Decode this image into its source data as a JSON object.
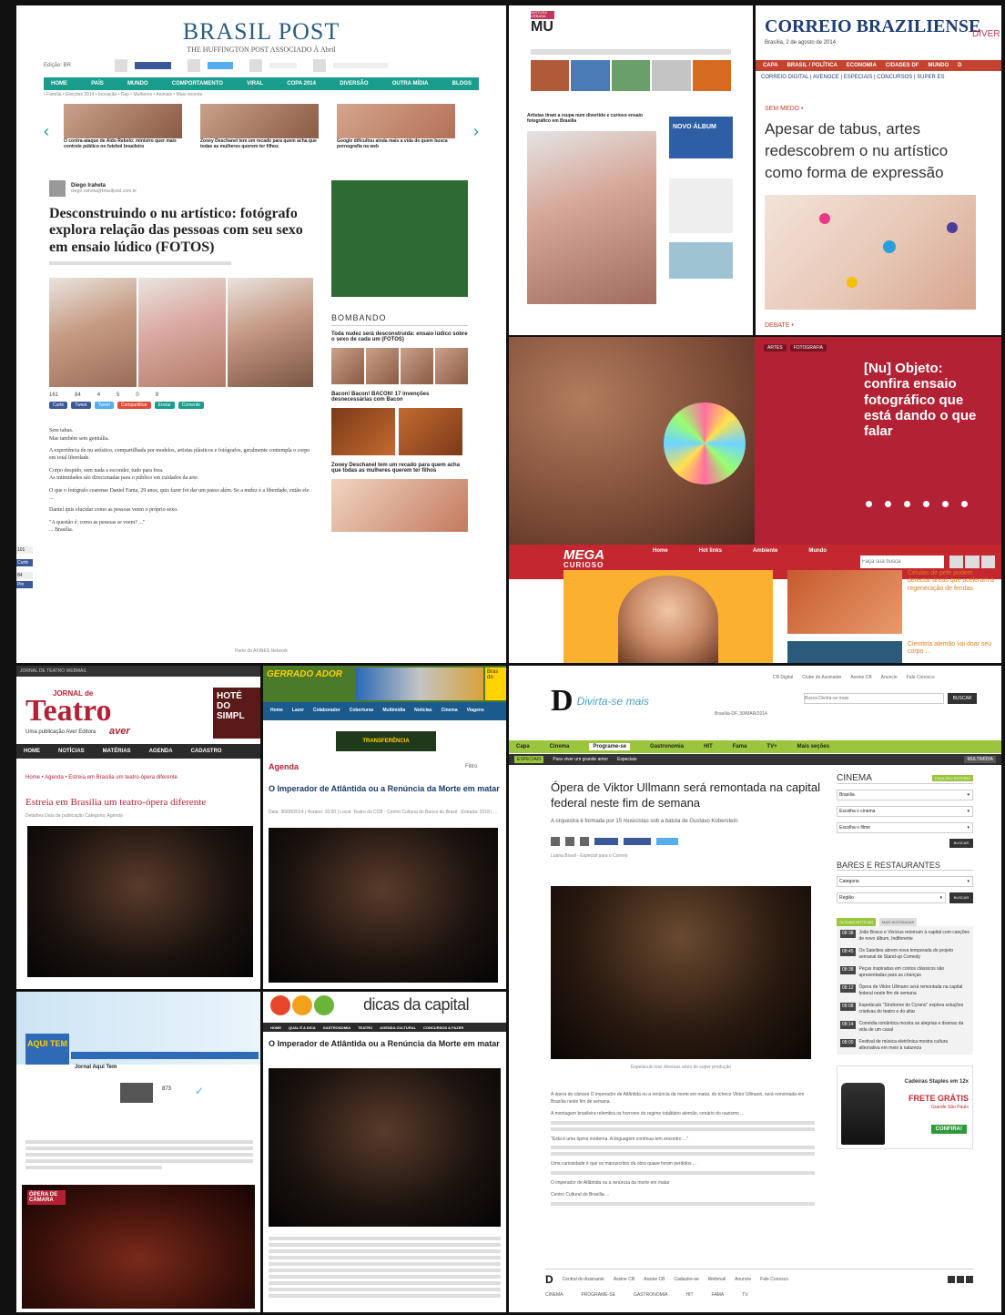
{
  "brasil_post": {
    "logo": "BRASIL POST",
    "subtitle": "THE HUFFINGTON POST ASSOCIADO À Abril",
    "edition": "Edição: BR",
    "nav": [
      "HOME",
      "PAÍS",
      "MUNDO",
      "COMPORTAMENTO",
      "VIRAL",
      "COPA 2014",
      "DIVERSÃO",
      "OUTRA MÍDIA",
      "BLOGS"
    ],
    "breadcrumb": "• Família • Eleições 2014 • Inovação • Gay • Mulheres • Animais • Mais recente",
    "carousel": [
      "O contra-ataque de Aldo Rebelo: ministro quer mais controle público no futebol brasileiro",
      "Zooey Deschanel tem um recado para quem acha que todas as mulheres querem ter filhos",
      "Google dificultou ainda mais a vida de quem busca pornografia na web"
    ],
    "author": "Diego Iraheta",
    "author_email": "diego.iraheta@brasilpost.com.br",
    "headline": "Desconstruindo o nu artístico: fotógrafo explora relação das pessoas com seu sexo em ensaio lúdico (FOTOS)",
    "counts": [
      "161",
      "84",
      "4",
      "5",
      "0",
      "9"
    ],
    "share_buttons": [
      "Curtir",
      "Tweet",
      "Tweet",
      "Compartilhar",
      "Enviar",
      "Comente"
    ],
    "body": [
      "Sem tabus.",
      "Mas também sem genitália.",
      "A experiência do nu artístico, compartilhada por modelos, artistas plásticos e fotógrafos, geralmente contempla o corpo em total liberdade.",
      "Corpo despido, sem nada a esconder, tudo para fora.",
      "As intimidades são direcionadas para o público em cuidados da arte.",
      "O que o fotógrafo cearense Daniel Fama, 29 anos, quis fazer foi dar um passo além. Se a nudez é a liberdade, então ele ...",
      "Daniel quis elucidar como as pessoas veem o próprio sexo.",
      "\"A questão é: como as pessoas se veem? ...\"",
      "... Brasília."
    ],
    "sidebar_title": "BOMBANDO",
    "sidebar_items": [
      "Toda nudez será desconstruída: ensaio lúdico sobre o sexo de cada um (FOTOS)",
      "Bacon! Bacon! BACON! 17 invenções desnecessárias com Bacon",
      "Zooey Deschanel tem um recado para quem acha que todas as mulheres querem ter filhos"
    ],
    "footer": "Parte do AFINES Network",
    "side_labels": [
      "101",
      "Curtir",
      "84",
      "Pin"
    ]
  },
  "mu": {
    "logo_top": "MISTURA URBANA",
    "logo": "MU",
    "headline": "Artistas tiram a roupa num divertido e curioso ensaio fotográfico em Brasília",
    "album_label": "NOVO ÁLBUM"
  },
  "correio": {
    "logo": "CORREIO BRAZILIENSE",
    "logo_right": "DIVER",
    "date": "Brasília, 2 de agosto de 2014",
    "nav": [
      "CAPA",
      "BRASIL / POLÍTICA",
      "ECONOMIA",
      "CIDADES DF",
      "MUNDO",
      "D"
    ],
    "subnav": "CORREIO DIGITAL | AVENOCE | ESPECIAIS | CONCURSOS | SUPER ES",
    "kicker": "SEM MEDO •",
    "headline": "Apesar de tabus, artes redescobrem o nu artístico como forma de expressão",
    "section": "DEBATE •"
  },
  "mega": {
    "tags": [
      "ARTES",
      "FOTOGRAFIA"
    ],
    "headline": "[Nu] Objeto: confira ensaio fotográfico que está dando o que falar",
    "logo_top": "MEGA",
    "logo_bottom": "CURIOSO",
    "nav": [
      "Home",
      "Hot links",
      "Ambiente",
      "Mundo"
    ],
    "search_placeholder": "Faça sua busca",
    "side_stories": [
      "Células de pele podem detectar áreas que aceleram a regeneração de feridas",
      "Cientista alemão vai doar seu corpo ..."
    ]
  },
  "teatro": {
    "topbar": "JORNAL DE TEATRO   WEBMAIL",
    "logo_small": "JORNAL de",
    "logo": "Teatro",
    "tagline": "Uma publicação Aver Editora",
    "publisher": "aver",
    "banner": "HOTÉ DO SIMPL",
    "nav": [
      "HOME",
      "NOTÍCIAS",
      "MATÉRIAS",
      "AGENDA",
      "CADASTRO"
    ],
    "breadcrumb": "Home  •  Agenda  •  Estreia em Brasília um teatro-ópera diferente",
    "headline": "Estreia em Brasília um teatro-ópera diferente",
    "meta": "Detalhes   Data de publicação   Categoria: Agenda"
  },
  "agenda": {
    "logo": "GERRADO ADOR",
    "banner_right": "Bras do",
    "nav": [
      "Home",
      "Lazer",
      "Colaborador",
      "Coberturas",
      "Multimídia",
      "Notícias",
      "Cinema",
      "Viagens"
    ],
    "ad": "TRANSFERÊNCIA",
    "section": "Agenda",
    "filter": "Filtro",
    "headline": "O Imperador de Atlântida ou a Renúncia da Morte em matar",
    "meta": "Data: 30/08/2014 | Horário: 20:00 | Local: Teatro do CCB - Centro Cultural do Banco do Brasil - Entrada: 2018 | ..."
  },
  "aqui": {
    "logo": "AQUI TEM",
    "paper": "Jornal Aqui Tem",
    "count": "873",
    "article_label": "ÓPERA DE CÂMARA"
  },
  "dicas": {
    "logo": "dicas da capital",
    "nav": [
      "HOME",
      "QUAL É A DICA",
      "GASTRONOMIA",
      "TEATRO",
      "AGENDA CULTURAL",
      "CONCURSOS & FAZER"
    ],
    "headline": "O Imperador de Atlântida ou a Renúncia da Morte em matar"
  },
  "divirta": {
    "logo": "Divirta-se mais",
    "topnav": [
      "CB Digital",
      "Clube do Assinante",
      "Assine CB",
      "Anuncie",
      "Fale Conosco"
    ],
    "search_placeholder": "Busca Divirta-se mais",
    "search_btn": "BUSCAR",
    "location": "Brasília-DF, 30/MAR/2014",
    "nav": [
      "Capa",
      "Cinema",
      "Programe-se",
      "Gastronomia",
      "HIT",
      "Fama",
      "TV+",
      "Mais seções"
    ],
    "subnav": [
      "ESPECIAIS",
      "Para viver um grande amor",
      "Especiais"
    ],
    "multimedia": "MULTIMÍDIA",
    "headline": "Ópera de Viktor Ullmann será remontada na capital federal neste fim de semana",
    "dek": "A orquestra é formada por 15 musicistas sob a batuta de Gustavo Koberstein.",
    "byline": "Luana Brasil - Especial para o Correio",
    "caption": "Espetáculo traz diversas artes de super produção",
    "body": [
      "A ópera de câmara O imperador de Atlântida ou a renúncia da morte em matar, do tcheco Viktor Ullmann, será remontada em Brasília neste fim de semana.",
      "A montagem brasileira relembra os horrores do regime totalitário alemão, cenário do nazismo ...",
      "\"Esta é uma ópera moderna. A linguagem contínua tem encontro ...\"",
      "Uma curiosidade é que os manuscritos da obra quase foram perdidos ...",
      "O imperador de Atlântida ou a renúncia da morte em matar",
      "Centro Cultural do Brasília ..."
    ],
    "side": {
      "cinema": "CINEMA",
      "cinema_badge": "FAÇA SEU ROTEIRO",
      "selects": [
        "Brasília",
        "Escolha o cinema",
        "Escolha o filme"
      ],
      "bares": "BARES E RESTAURANTES",
      "bares_selects": [
        "Categoria",
        "Região"
      ],
      "tabs": [
        "ÚLTIMAS NOTÍCIAS",
        "MAIS ACESSADAS"
      ],
      "news": [
        {
          "time": "08:38",
          "text": "João Bosco e Vinícius retornam à capital com canções de novo álbum, Indiferente"
        },
        {
          "time": "08:45",
          "text": "Os Satelites abrem nova temporada do projeto semanal de Stand-up Comedy"
        },
        {
          "time": "08:38",
          "text": "Peças inspiradas em contos clássicos são apresentadas para as crianças"
        },
        {
          "time": "08:12",
          "text": "Ópera de Viktor Ullmann será remontada na capital federal neste fim de semana"
        },
        {
          "time": "08:08",
          "text": "Espetáculo \"Síndrome do Cyrano\" explora soluções criativas do teatro e do altar"
        },
        {
          "time": "08:14",
          "text": "Comédia romântica mostra as alegrias e dramas da vida de um casal"
        },
        {
          "time": "08:00",
          "text": "Festival de música eletrônica mostra cultura alternativa em meio à natureza"
        }
      ],
      "ad_title": "Cadeiras Staples em 12x",
      "ad_free": "FRETE GRÁTIS",
      "ad_free_note": "Grande São Paulo",
      "ad_btn": "CONFIRA!"
    },
    "footer_links": [
      "Central do Assinante",
      "Assine CB",
      "Assine CB",
      "Cadastre-se",
      "Webmail",
      "Anuncie",
      "Fale Conosco"
    ],
    "footer_nav": [
      "CINEMA",
      "PROGRAME-SE",
      "GASTRONOMIA",
      "HIT",
      "FAMA",
      "TV"
    ]
  }
}
